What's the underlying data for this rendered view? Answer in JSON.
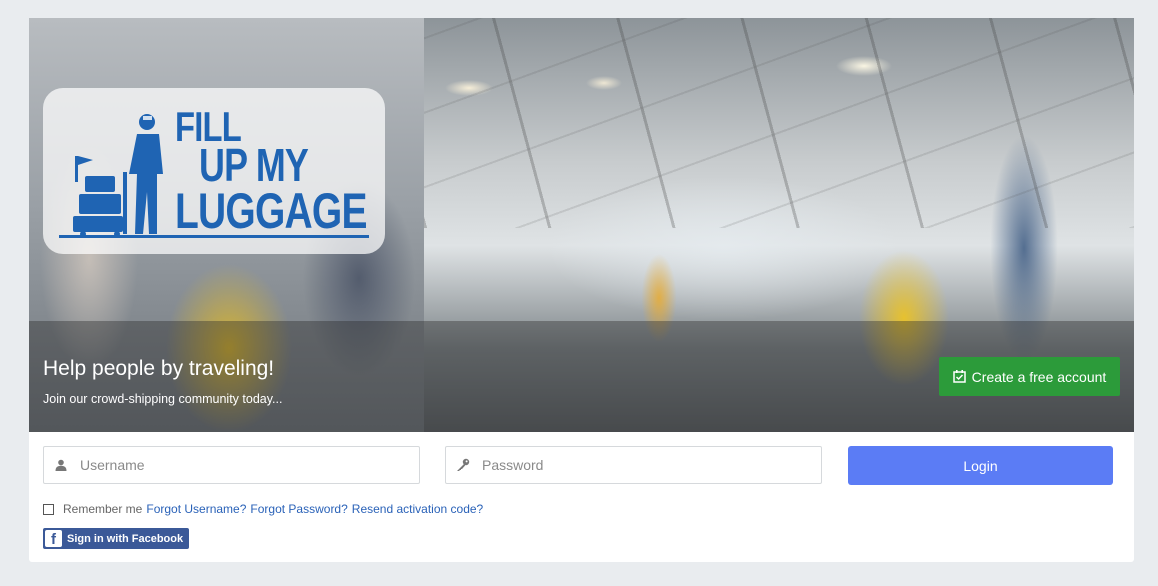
{
  "hero": {
    "title": "Help people by traveling!",
    "subtitle": "Join our crowd-shipping community today...",
    "create_account_label": "Create a free account"
  },
  "logo": {
    "line1": "FILL",
    "line2": "UP MY",
    "line3": "LUGGAGE"
  },
  "login": {
    "username_placeholder": "Username",
    "username_value": "",
    "password_placeholder": "Password",
    "password_value": "",
    "login_label": "Login",
    "remember_label": "Remember me",
    "remember_checked": false,
    "links": {
      "forgot_username": "Forgot Username?",
      "forgot_password": "Forgot Password?",
      "resend": "Resend activation code?"
    },
    "facebook_label": "Sign in with Facebook"
  },
  "icons": {
    "username": "user-icon",
    "password": "key-icon",
    "create": "calendar-check-icon",
    "facebook": "facebook-icon"
  },
  "colors": {
    "create_button": "#2c9b3a",
    "login_button": "#5b7cf5",
    "link": "#2a62b8",
    "facebook": "#3b5998",
    "logo": "#1f64b3"
  }
}
